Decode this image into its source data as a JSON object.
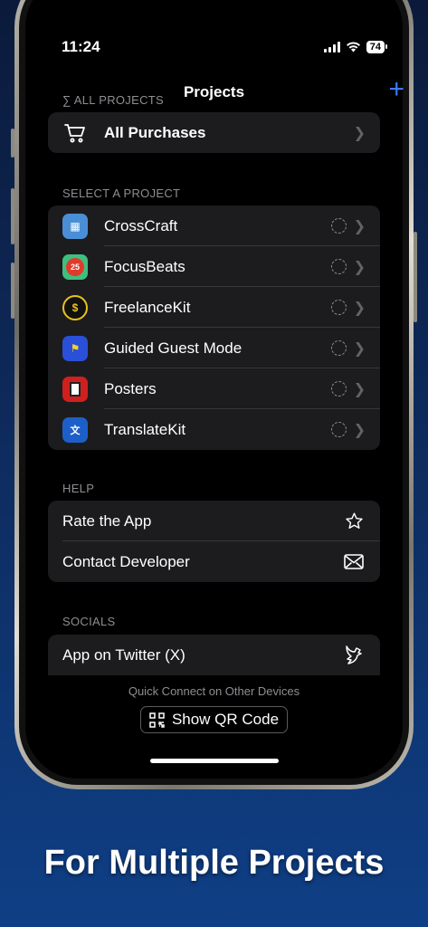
{
  "status_bar": {
    "time": "11:24",
    "battery": "74"
  },
  "nav": {
    "title": "Projects",
    "add_label": "+"
  },
  "all_projects": {
    "header": "∑ ALL PROJECTS",
    "item": {
      "label": "All Purchases",
      "icon": "cart-icon"
    }
  },
  "select_project": {
    "header": "SELECT A PROJECT",
    "items": [
      {
        "label": "CrossCraft",
        "icon": "crosscraft-app-icon",
        "color": "#4a8fd6"
      },
      {
        "label": "FocusBeats",
        "icon": "focusbeats-app-icon",
        "color": "#3fbf7f"
      },
      {
        "label": "FreelanceKit",
        "icon": "freelancekit-app-icon",
        "color": "#e8c21e"
      },
      {
        "label": "Guided Guest Mode",
        "icon": "guided-guest-mode-app-icon",
        "color": "#2a4fd8"
      },
      {
        "label": "Posters",
        "icon": "posters-app-icon",
        "color": "#d0201e"
      },
      {
        "label": "TranslateKit",
        "icon": "translatekit-app-icon",
        "color": "#1d5fc8"
      }
    ]
  },
  "help": {
    "header": "HELP",
    "items": [
      {
        "label": "Rate the App",
        "icon": "star-icon"
      },
      {
        "label": "Contact Developer",
        "icon": "envelope-icon"
      }
    ]
  },
  "socials": {
    "header": "SOCIALS",
    "items": [
      {
        "label": "App on Twitter (X)",
        "icon": "bird-icon"
      }
    ]
  },
  "quick_connect": {
    "caption": "Quick Connect on Other Devices",
    "button_label": "Show QR Code"
  },
  "tagline": "For Multiple Projects"
}
